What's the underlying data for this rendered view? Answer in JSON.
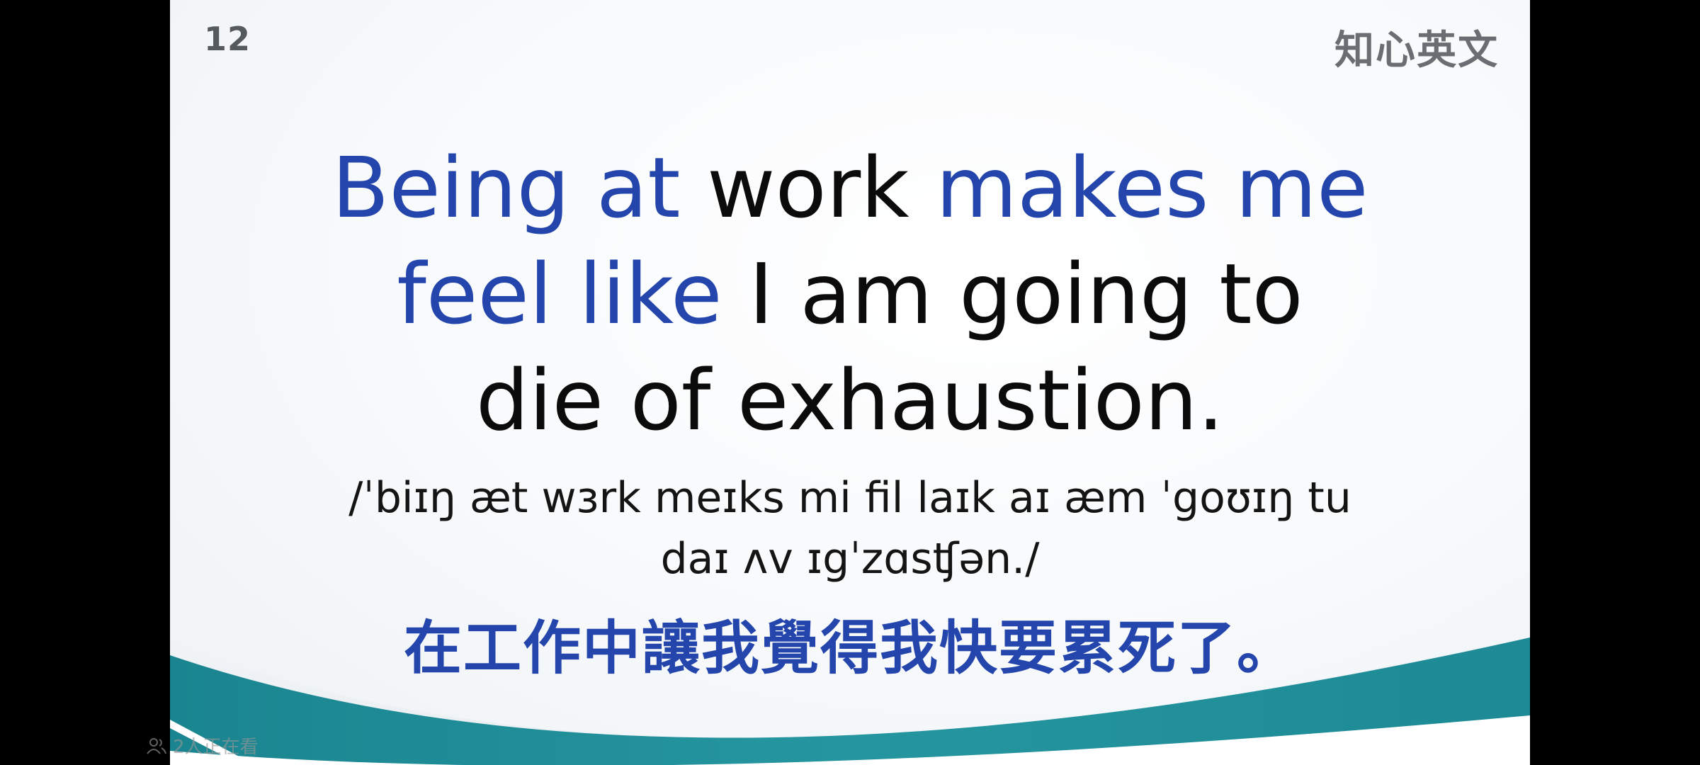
{
  "slide": {
    "page_number": "12",
    "brand": "知心英文",
    "sentence": {
      "line1": [
        {
          "text": "Being at ",
          "highlight": true
        },
        {
          "text": "work ",
          "highlight": false
        },
        {
          "text": "makes me",
          "highlight": true
        }
      ],
      "line2": [
        {
          "text": "feel like ",
          "highlight": true
        },
        {
          "text": "I am going to",
          "highlight": false
        }
      ],
      "line3": [
        {
          "text": "die of exhaustion.",
          "highlight": false
        }
      ]
    },
    "ipa": {
      "line1": "/ˈbiɪŋ æt wɜrk meɪks mi fil laɪk aɪ æm ˈgoʊɪŋ tu",
      "line2": "daɪ ʌv ɪgˈzɑsʧən./"
    },
    "translation": "在工作中讓我覺得我快要累死了。"
  },
  "overlay": {
    "viewers_text": "2人正在看",
    "icon": "people-icon"
  },
  "colors": {
    "highlight": "#2446ac",
    "body_text": "#0b0b0b",
    "wave_teal": "#1e8f98",
    "letterbox": "#000000"
  }
}
